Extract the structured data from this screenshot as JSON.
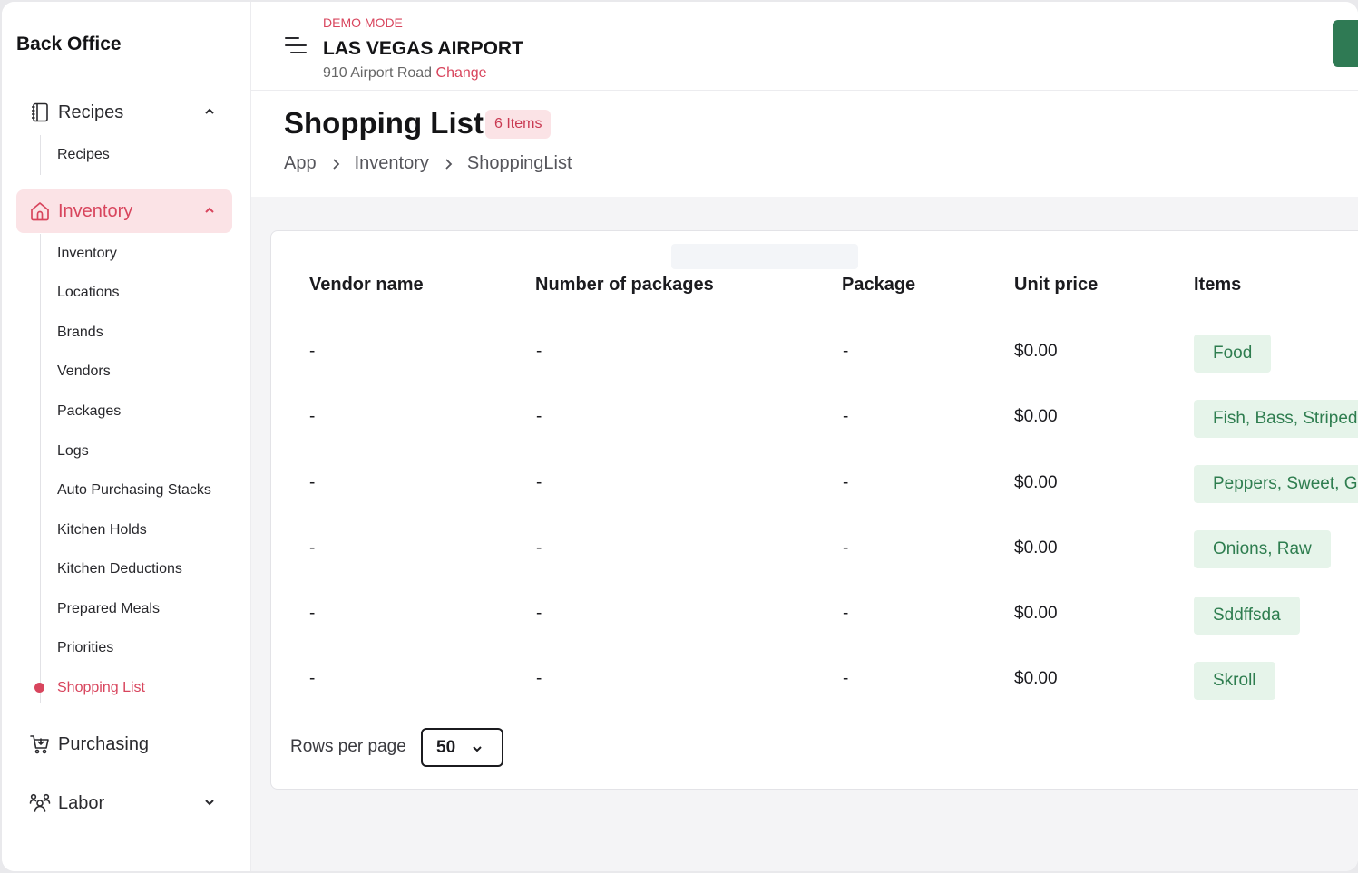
{
  "sidebar": {
    "brand": "Back Office",
    "groups": [
      {
        "label": "Recipes",
        "icon": "book-icon",
        "expanded": true
      },
      {
        "label": "Inventory",
        "icon": "home-icon",
        "expanded": true,
        "active": true
      },
      {
        "label": "Purchasing",
        "icon": "cart-icon"
      },
      {
        "label": "Labor",
        "icon": "users-icon",
        "expanded": false
      }
    ],
    "recipes_items": [
      "Recipes"
    ],
    "inventory_items": [
      "Inventory",
      "Locations",
      "Brands",
      "Vendors",
      "Packages",
      "Logs",
      "Auto Purchasing Stacks",
      "Kitchen Holds",
      "Kitchen Deductions",
      "Prepared Meals",
      "Priorities",
      "Shopping List"
    ],
    "active_item": "Shopping List",
    "accent": "#d8455d"
  },
  "header": {
    "mode": "DEMO MODE",
    "location_name": "LAS VEGAS AIRPORT",
    "address": "910 Airport Road",
    "change_label": "Change"
  },
  "page": {
    "title": "Shopping List",
    "count_badge": "6 Items",
    "breadcrumb": [
      "App",
      "Inventory",
      "ShoppingList"
    ]
  },
  "table": {
    "columns": [
      "Vendor name",
      "Number of packages",
      "Package",
      "Unit price",
      "Items"
    ],
    "rows": [
      {
        "vendor": "-",
        "packages": "-",
        "package": "-",
        "unit_price": "$0.00",
        "item": "Food"
      },
      {
        "vendor": "-",
        "packages": "-",
        "package": "-",
        "unit_price": "$0.00",
        "item": "Fish, Bass, Striped"
      },
      {
        "vendor": "-",
        "packages": "-",
        "package": "-",
        "unit_price": "$0.00",
        "item": "Peppers, Sweet, G"
      },
      {
        "vendor": "-",
        "packages": "-",
        "package": "-",
        "unit_price": "$0.00",
        "item": "Onions, Raw"
      },
      {
        "vendor": "-",
        "packages": "-",
        "package": "-",
        "unit_price": "$0.00",
        "item": "Sddffsda"
      },
      {
        "vendor": "-",
        "packages": "-",
        "package": "-",
        "unit_price": "$0.00",
        "item": "Skroll"
      }
    ]
  },
  "pagination": {
    "rows_per_page_label": "Rows per page",
    "rows_per_page_value": "50"
  }
}
